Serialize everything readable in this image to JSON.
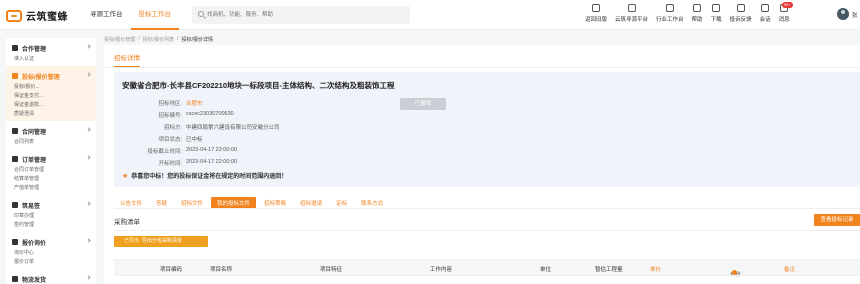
{
  "header": {
    "logo_text": "云筑蜜蜂",
    "nav": [
      {
        "label": "寻源工作台"
      },
      {
        "label": "投标工作台"
      }
    ],
    "search_placeholder": "找商机、功能、服务、帮助",
    "tools": [
      {
        "label": "返回旧版",
        "icon": "home-icon"
      },
      {
        "label": "云筑寻源平台",
        "icon": "platform-icon"
      },
      {
        "label": "行业工作台",
        "icon": "workbench-icon"
      },
      {
        "label": "帮助",
        "icon": "help-icon"
      },
      {
        "label": "下载",
        "icon": "download-icon"
      },
      {
        "label": "投诉反馈",
        "icon": "feedback-icon"
      },
      {
        "label": "会话",
        "icon": "chat-icon"
      },
      {
        "label": "消息",
        "icon": "bell-icon",
        "badge": "99+"
      }
    ],
    "user_name": "张"
  },
  "sidebar": {
    "menus": [
      {
        "title": "合作管理",
        "icon": "handshake-icon",
        "subs": [
          "准入认证"
        ]
      },
      {
        "title": "投标/报价管理",
        "icon": "bid-icon",
        "subs": [
          "投标/报价...",
          "保证金支付...",
          "保证金退款...",
          "质疑澄清"
        ]
      },
      {
        "title": "合同管理",
        "icon": "contract-icon",
        "subs": [
          "合同列表"
        ]
      },
      {
        "title": "订单管理",
        "icon": "order-icon",
        "subs": [
          "合同订单管理",
          "结算单管理",
          "产值单管理"
        ]
      },
      {
        "title": "筑易签",
        "icon": "sign-icon",
        "subs": [
          "印章办理",
          "签约管理"
        ]
      },
      {
        "title": "报价询价",
        "icon": "inquiry-icon",
        "subs": [
          "询价中心",
          "报价订单"
        ]
      },
      {
        "title": "物流发货",
        "icon": "truck-icon",
        "subs": []
      }
    ]
  },
  "breadcrumb": [
    "投标/报价管理",
    "投标/报价列表",
    "投标/报价详情"
  ],
  "main": {
    "tab": "招标详情",
    "project_title": "安徽省合肥市-长丰县CF202210地块一标段项目-主体结构、二次结构及粗装饰工程",
    "stamp": "已撤销",
    "fields": [
      {
        "k": "招标地区:",
        "v": "合肥市",
        "link": true
      },
      {
        "k": "招标编号:",
        "v": "cscec23030700630"
      },
      {
        "k": "招标方:",
        "v": "中建四局第六建设有限公司安徽分公司"
      },
      {
        "k": "项目状态:",
        "v": "已中标"
      },
      {
        "k": "投标截止时间:",
        "v": "2023-04-17 22:00:00"
      },
      {
        "k": "开标时间:",
        "v": "2023-04-17 22:00:00"
      }
    ],
    "congrats": "恭喜您中标！您的投标保证金将在规定的时间范围内退回！",
    "detail_tabs": [
      "公告文件",
      "答疑",
      "招标文件",
      "我的投标文件",
      "招标策略",
      "招标邀请",
      "定标",
      "联系方式"
    ],
    "active_tab_index": 3,
    "purchase_title": "采购清单",
    "view_btn": "查看投标记录",
    "import_tag": "已导出",
    "import_label": "导出分包采购清单",
    "table_headers": [
      "项目编码",
      "项目名称",
      "项目特征",
      "工作内容",
      "单位",
      "暂估工程量",
      "单价",
      "合价",
      "备注"
    ]
  }
}
